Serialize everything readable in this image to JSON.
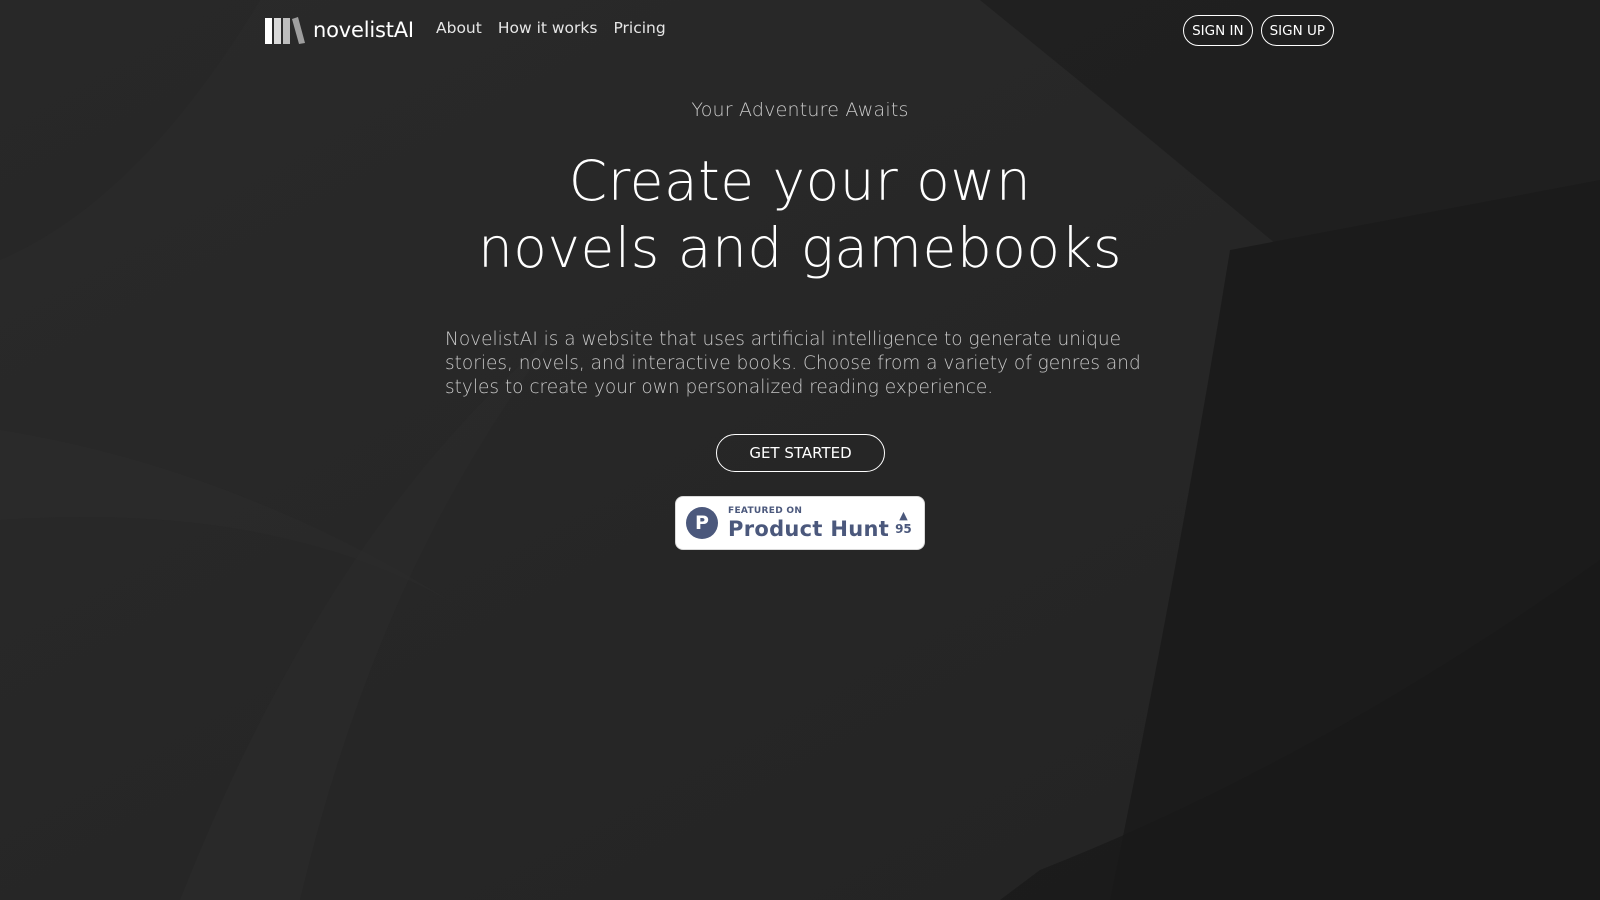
{
  "brand": {
    "name": "novelistAI"
  },
  "nav": {
    "links": [
      "About",
      "How it works",
      "Pricing"
    ]
  },
  "auth": {
    "sign_in": "SIGN IN",
    "sign_up": "SIGN UP"
  },
  "hero": {
    "eyebrow": "Your Adventure Awaits",
    "headline_line1": "Create your own",
    "headline_line2": "novels and gamebooks",
    "description": "NovelistAI is a website that uses artificial intelligence to generate unique stories, novels, and interactive books. Choose from a variety of genres and styles to create your own personalized reading experience.",
    "cta": "GET STARTED"
  },
  "product_hunt": {
    "featured_on": "FEATURED ON",
    "name": "Product Hunt",
    "logo_letter": "P",
    "votes": "95",
    "arrow": "▲"
  },
  "colors": {
    "background": "#262626",
    "text": "#ffffff",
    "product_hunt": "#4b587c"
  }
}
